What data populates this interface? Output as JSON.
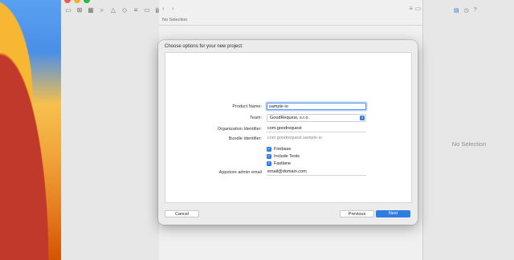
{
  "xcode": {
    "editor": {
      "no_selection": "No Selection"
    },
    "inspector": {
      "no_selection": "No Selection"
    }
  },
  "dialog": {
    "title": "Choose options for your new project:",
    "fields": {
      "product_name": {
        "label": "Product Name:",
        "value": "sample-io"
      },
      "team": {
        "label": "Team:",
        "value": "GoodRequest, s.r.o."
      },
      "organization_identifier": {
        "label": "Organization Identifier:",
        "value": "com.goodrequest"
      },
      "bundle_identifier": {
        "label": "Bundle Identifier:",
        "value": "com.goodrequest.sample-io"
      },
      "appstore_admin_email": {
        "label": "Appstore admin email",
        "value": "email@domain.com"
      }
    },
    "checkboxes": [
      {
        "label": "Firebase",
        "checked": true
      },
      {
        "label": "Include Tests",
        "checked": true
      },
      {
        "label": "Fastlane",
        "checked": true
      }
    ],
    "buttons": {
      "cancel": "Cancel",
      "previous": "Previous",
      "next": "Next"
    }
  },
  "colors": {
    "accent": "#2f7de1",
    "focus_ring": "#5b9bf0"
  }
}
